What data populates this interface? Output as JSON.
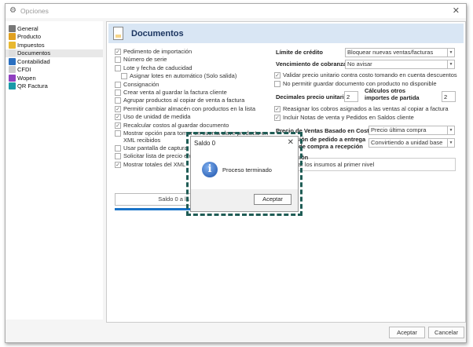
{
  "window": {
    "title": "Opciones",
    "close": "✕"
  },
  "sidebar": {
    "items": [
      {
        "label": "General",
        "color": "#777"
      },
      {
        "label": "Producto",
        "color": "#e0a020"
      },
      {
        "label": "Impuestos",
        "color": "#e8b830"
      },
      {
        "label": "Documentos",
        "color": "#ddd"
      },
      {
        "label": "Contabilidad",
        "color": "#2a6fc0"
      },
      {
        "label": "CFDI",
        "color": "#ccc"
      },
      {
        "label": "Wopen",
        "color": "#9040c0"
      },
      {
        "label": "QR Factura",
        "color": "#1a9aa8"
      }
    ],
    "active": 3
  },
  "header": {
    "title": "Documentos"
  },
  "left_checks": [
    {
      "label": "Pedimento de importación",
      "checked": true
    },
    {
      "label": "Número de serie",
      "checked": false
    },
    {
      "label": "Lote y fecha de caducidad",
      "checked": false
    },
    {
      "label": "Asignar lotes en automático (Solo salida)",
      "checked": false
    },
    {
      "label": "Consignación",
      "checked": false
    },
    {
      "label": "Crear venta al guardar la factura cliente",
      "checked": false
    },
    {
      "label": "Agrupar productos al copiar de venta a factura",
      "checked": false
    },
    {
      "label": "Permitir cambiar almacén con productos en la lista",
      "checked": true
    },
    {
      "label": "Uso de unidad de medida",
      "checked": true
    },
    {
      "label": "Recalcular costos al guardar documento",
      "checked": true
    },
    {
      "label": "Mostrar opción para tomar en cuenta clave producto en XML recibidos",
      "checked": false
    },
    {
      "label": "Usar pantalla de captura",
      "checked": false
    },
    {
      "label": "Solicitar lista de precio en",
      "checked": false
    },
    {
      "label": "Mostrar totales del XML",
      "checked": true
    }
  ],
  "right": {
    "limite_label": "Límite de crédito",
    "limite_value": "Bloquear nuevas ventas/facturas",
    "venc_label": "Vencimiento de cobranza",
    "venc_value": "No avisar",
    "check_validar": "Validar precio unitario contra costo tomando en cuenta descuentos",
    "check_nopermitir": "No permitir guardar documento con producto no disponible",
    "dec_label": "Decimales precio unitario",
    "dec_value": "2",
    "calc_label": "Cálculos otros importes de partida",
    "calc_value": "2",
    "check_reasignar": "Reasignar los cobros asignados a las ventas al copiar a factura",
    "check_incluir": "Incluir Notas de venta y Pedidos en Saldos cliente",
    "precio_label": "Precio de Ventas Basado en Costeo",
    "precio_value": "Precio última compra",
    "conv_label": "Conversión de pedido a entrega y orden de compra a recepción",
    "conv_value": "Convirtiendo a unidad base",
    "group_label": "Producción",
    "check_afectar": "Afectar los insumos al primer nivel"
  },
  "progress": {
    "label": "Saldo 0 a la",
    "value": 1.0
  },
  "footer": {
    "ok": "Aceptar",
    "cancel": "Cancelar"
  },
  "dialog": {
    "title": "Saldo 0",
    "message": "Proceso terminado",
    "ok": "Aceptar",
    "close": "✕"
  }
}
